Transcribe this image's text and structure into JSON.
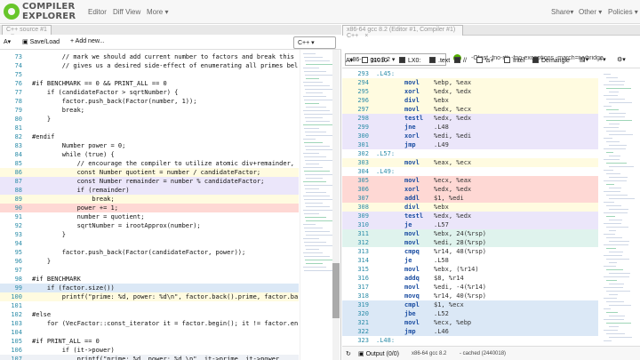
{
  "nav": {
    "logo_lines": [
      "COMPILER",
      "EXPLORER"
    ],
    "left": [
      "Editor",
      "Diff View",
      "More ▾"
    ],
    "right": [
      "Share▾",
      "Other ▾",
      "Policies ▾"
    ]
  },
  "left": {
    "tab_title": "C++ source #1",
    "tab_close": "×",
    "toolbar": {
      "font": "A▾",
      "save_load": "Save/Load",
      "add_new": "+ Add new...",
      "language": "C++"
    },
    "lines": [
      {
        "no": "73",
        "code": "        // mark we should add current number to factors and break this",
        "bg": ""
      },
      {
        "no": "74",
        "code": "        // gives us a desired side-effect of enumerating all primes bel",
        "bg": ""
      },
      {
        "no": "75",
        "code": "",
        "bg": ""
      },
      {
        "no": "76",
        "code": "#if BENCHMARK == 0 && PRINT_ALL == 0",
        "bg": ""
      },
      {
        "no": "77",
        "code": "    if (candidateFactor > sqrtNumber) {",
        "bg": ""
      },
      {
        "no": "78",
        "code": "        factor.push_back(Factor(number, 1));",
        "bg": ""
      },
      {
        "no": "79",
        "code": "        break;",
        "bg": ""
      },
      {
        "no": "80",
        "code": "    }",
        "bg": ""
      },
      {
        "no": "81",
        "code": "",
        "bg": ""
      },
      {
        "no": "82",
        "code": "#endif",
        "bg": ""
      },
      {
        "no": "83",
        "code": "        Number power = 0;",
        "bg": ""
      },
      {
        "no": "84",
        "code": "        while (true) {",
        "bg": ""
      },
      {
        "no": "85",
        "code": "            // encourage the compiler to utilize atomic div+remainder,",
        "bg": ""
      },
      {
        "no": "86",
        "code": "            const Number quotient = number / candidateFactor;",
        "bg": "hl-yellow"
      },
      {
        "no": "87",
        "code": "            const Number remainder = number % candidateFactor;",
        "bg": "hl-purple"
      },
      {
        "no": "88",
        "code": "            if (remainder)",
        "bg": "hl-purple"
      },
      {
        "no": "89",
        "code": "                break;",
        "bg": "hl-yellow"
      },
      {
        "no": "90",
        "code": "            power += 1;",
        "bg": "hl-red"
      },
      {
        "no": "91",
        "code": "            number = quotient;",
        "bg": ""
      },
      {
        "no": "92",
        "code": "            sqrtNumber = irootApprox(number);",
        "bg": ""
      },
      {
        "no": "93",
        "code": "        }",
        "bg": ""
      },
      {
        "no": "94",
        "code": "",
        "bg": ""
      },
      {
        "no": "95",
        "code": "        factor.push_back(Factor(candidateFactor, power));",
        "bg": ""
      },
      {
        "no": "96",
        "code": "    }",
        "bg": ""
      },
      {
        "no": "97",
        "code": "",
        "bg": ""
      },
      {
        "no": "98",
        "code": "#if BENCHMARK",
        "bg": ""
      },
      {
        "no": "99",
        "code": "    if (factor.size())",
        "bg": "hl-blue"
      },
      {
        "no": "100",
        "code": "        printf(\"prime: %d, power: %d\\n\", factor.back().prime, factor.ba",
        "bg": "hl-yellow"
      },
      {
        "no": "101",
        "code": "",
        "bg": ""
      },
      {
        "no": "102",
        "code": "#else",
        "bg": ""
      },
      {
        "no": "103",
        "code": "    for (VecFactor::const_iterator it = factor.begin(); it != factor.en",
        "bg": ""
      },
      {
        "no": "104",
        "code": "",
        "bg": ""
      },
      {
        "no": "105",
        "code": "#if PRINT_ALL == 0",
        "bg": ""
      },
      {
        "no": "106",
        "code": "        if (it->power)",
        "bg": ""
      },
      {
        "no": "107",
        "code": "            printf(\"prime: %d, power: %d \\n\", it->prime, it->power",
        "bg": "hl-gray"
      }
    ]
  },
  "right": {
    "tab_title": "x86-64 gcc 8.2 (Editor #1, Compiler #1) C++",
    "tab_close": "×",
    "compiler": {
      "name": "x86-64 gcc 8.2",
      "status_icon": "check-circle-icon",
      "flags": "-Ofast -fno-rtti -fno-exceptions -march=ivybridge"
    },
    "filters": [
      "A▾",
      "11010",
      "LX0:",
      ".text",
      "//",
      "\\s+",
      "Intel",
      "Demangle"
    ],
    "menu_icons": [
      "document-icon",
      "plus-icon",
      "gear-icon"
    ],
    "lines": [
      {
        "no": "293",
        "label": ".L45:",
        "op": "",
        "args": "",
        "bg": ""
      },
      {
        "no": "294",
        "label": "",
        "op": "movl",
        "args": "%ebp, %eax",
        "bg": "hl-yellow"
      },
      {
        "no": "295",
        "label": "",
        "op": "xorl",
        "args": "%edx, %edx",
        "bg": "hl-yellow"
      },
      {
        "no": "296",
        "label": "",
        "op": "divl",
        "args": "%ebx",
        "bg": "hl-yellow"
      },
      {
        "no": "297",
        "label": "",
        "op": "movl",
        "args": "%edx, %ecx",
        "bg": "hl-yellow"
      },
      {
        "no": "298",
        "label": "",
        "op": "testl",
        "args": "%edx, %edx",
        "bg": "hl-purple"
      },
      {
        "no": "299",
        "label": "",
        "op": "jne",
        "args": ".L48",
        "bg": "hl-purple"
      },
      {
        "no": "300",
        "label": "",
        "op": "xorl",
        "args": "%edi, %edi",
        "bg": "hl-purple"
      },
      {
        "no": "301",
        "label": "",
        "op": "jmp",
        "args": ".L49",
        "bg": "hl-purple"
      },
      {
        "no": "302",
        "label": ".L57:",
        "op": "",
        "args": "",
        "bg": ""
      },
      {
        "no": "303",
        "label": "",
        "op": "movl",
        "args": "%eax, %ecx",
        "bg": "hl-yellow"
      },
      {
        "no": "304",
        "label": ".L49:",
        "op": "",
        "args": "",
        "bg": ""
      },
      {
        "no": "305",
        "label": "",
        "op": "movl",
        "args": "%ecx, %eax",
        "bg": "hl-red"
      },
      {
        "no": "306",
        "label": "",
        "op": "xorl",
        "args": "%edx, %edx",
        "bg": "hl-red"
      },
      {
        "no": "307",
        "label": "",
        "op": "addl",
        "args": "$1, %edi",
        "bg": "hl-red"
      },
      {
        "no": "308",
        "label": "",
        "op": "divl",
        "args": "%ebx",
        "bg": "hl-yellow"
      },
      {
        "no": "309",
        "label": "",
        "op": "testl",
        "args": "%edx, %edx",
        "bg": "hl-purple"
      },
      {
        "no": "310",
        "label": "",
        "op": "je",
        "args": ".L57",
        "bg": "hl-purple"
      },
      {
        "no": "311",
        "label": "",
        "op": "movl",
        "args": "%ebx, 24(%rsp)",
        "bg": "hl-teal"
      },
      {
        "no": "312",
        "label": "",
        "op": "movl",
        "args": "%edi, 28(%rsp)",
        "bg": "hl-teal"
      },
      {
        "no": "313",
        "label": "",
        "op": "cmpq",
        "args": "%r14, 48(%rsp)",
        "bg": ""
      },
      {
        "no": "314",
        "label": "",
        "op": "je",
        "args": ".L58",
        "bg": ""
      },
      {
        "no": "315",
        "label": "",
        "op": "movl",
        "args": "%ebx, (%r14)",
        "bg": ""
      },
      {
        "no": "316",
        "label": "",
        "op": "addq",
        "args": "$8, %r14",
        "bg": ""
      },
      {
        "no": "317",
        "label": "",
        "op": "movl",
        "args": "%edi, -4(%r14)",
        "bg": ""
      },
      {
        "no": "318",
        "label": "",
        "op": "movq",
        "args": "%r14, 40(%rsp)",
        "bg": ""
      },
      {
        "no": "319",
        "label": "",
        "op": "cmpl",
        "args": "$1, %ecx",
        "bg": "hl-blue"
      },
      {
        "no": "320",
        "label": "",
        "op": "jbe",
        "args": ".L52",
        "bg": "hl-blue"
      },
      {
        "no": "321",
        "label": "",
        "op": "movl",
        "args": "%ecx, %ebp",
        "bg": "hl-blue"
      },
      {
        "no": "322",
        "label": "",
        "op": "jmp",
        "args": ".L46",
        "bg": "hl-blue"
      },
      {
        "no": "323",
        "label": ".L48:",
        "op": "",
        "args": "",
        "bg": ""
      }
    ],
    "bottom": {
      "refresh_icon": "refresh-icon",
      "output": "Output (0/0)",
      "compiler_status": "x86-64 gcc 8.2",
      "cached": "- cached (2440018)"
    }
  }
}
